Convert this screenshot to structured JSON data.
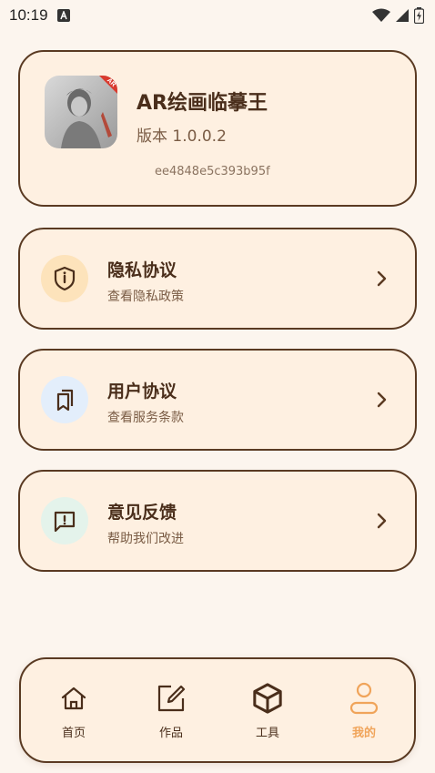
{
  "status_bar": {
    "time": "10:19",
    "notification_icon": "a-letter-icon",
    "icons": [
      "wifi-icon",
      "signal-icon",
      "battery-icon"
    ]
  },
  "app_info": {
    "name": "AR绘画临摹王",
    "version": "版本 1.0.0.2",
    "hash": "ee4848e5c393b95f",
    "logo_badge": "AR"
  },
  "menu": [
    {
      "title": "隐私协议",
      "subtitle": "查看隐私政策",
      "icon": "shield-icon",
      "icon_bg": "#FDE3BB"
    },
    {
      "title": "用户协议",
      "subtitle": "查看服务条款",
      "icon": "bookmarks-icon",
      "icon_bg": "#E3EEFB"
    },
    {
      "title": "意见反馈",
      "subtitle": "帮助我们改进",
      "icon": "feedback-icon",
      "icon_bg": "#E4F3EB"
    }
  ],
  "nav": {
    "items": [
      {
        "label": "首页",
        "icon": "home-icon"
      },
      {
        "label": "作品",
        "icon": "edit-icon"
      },
      {
        "label": "工具",
        "icon": "box-icon"
      },
      {
        "label": "我的",
        "icon": "user-icon"
      }
    ],
    "active_index": 3,
    "active_color": "#F0A45A"
  },
  "colors": {
    "background": "#FCF5EE",
    "card": "#FEF0E1",
    "border": "#5A3A22",
    "text": "#4A2E1B"
  }
}
